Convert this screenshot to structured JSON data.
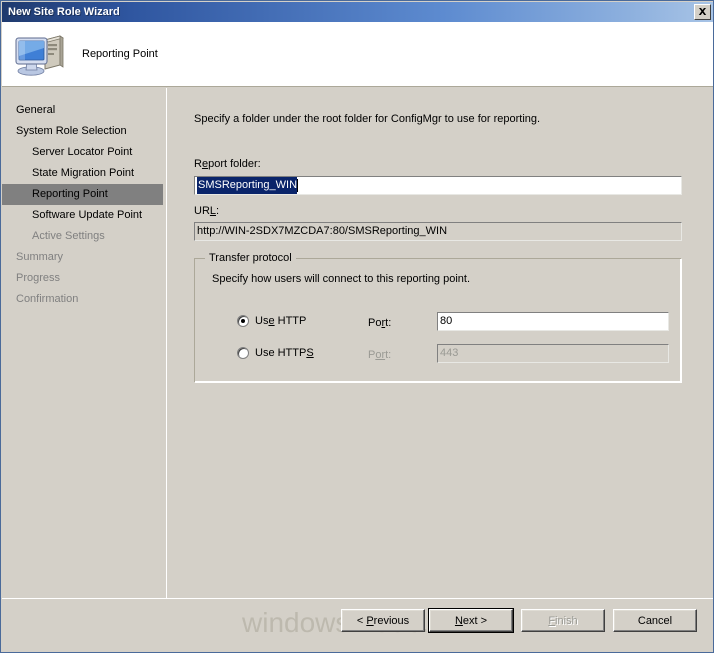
{
  "window": {
    "title": "New Site Role Wizard",
    "close_label": "close-icon"
  },
  "header": {
    "title": "Reporting Point",
    "icon": "computer-icon"
  },
  "sidebar": {
    "items": [
      {
        "label": "General",
        "indent": false,
        "state": "normal"
      },
      {
        "label": "System Role Selection",
        "indent": false,
        "state": "normal"
      },
      {
        "label": "Server Locator Point",
        "indent": true,
        "state": "normal"
      },
      {
        "label": "State Migration Point",
        "indent": true,
        "state": "normal"
      },
      {
        "label": "Reporting Point",
        "indent": true,
        "state": "selected"
      },
      {
        "label": "Software Update Point",
        "indent": true,
        "state": "normal"
      },
      {
        "label": "Active Settings",
        "indent": true,
        "state": "dim"
      },
      {
        "label": "Summary",
        "indent": false,
        "state": "dim"
      },
      {
        "label": "Progress",
        "indent": false,
        "state": "dim"
      },
      {
        "label": "Confirmation",
        "indent": false,
        "state": "dim"
      }
    ]
  },
  "content": {
    "intro": "Specify a folder under the root folder for ConfigMgr to use for reporting.",
    "report_folder": {
      "label_pre": "R",
      "label_acc": "e",
      "label_post": "port folder:",
      "label_full": "Report folder:",
      "value": "SMSReporting_WIN",
      "selected": true
    },
    "url": {
      "label_pre": "UR",
      "label_acc": "L",
      "label_post": ":",
      "label_full": "URL:",
      "value": "http://WIN-2SDX7MZCDA7:80/SMSReporting_WIN",
      "readonly": true
    },
    "transfer_protocol": {
      "legend": "Transfer protocol",
      "description": "Specify how users will connect to this reporting point.",
      "options": [
        {
          "label_pre": "Us",
          "label_acc": "e",
          "label_post": " HTTP",
          "label_full": "Use HTTP",
          "checked": true,
          "port_label_pre": "Po",
          "port_label_acc": "r",
          "port_label_post": "t:",
          "port_label_full": "Port:",
          "port_value": "80",
          "port_enabled": true
        },
        {
          "label_pre": "Use HTTP",
          "label_acc": "S",
          "label_post": "",
          "label_full": "Use HTTPS",
          "checked": false,
          "port_label_pre": "P",
          "port_label_acc": "or",
          "port_label_post": "t:",
          "port_label_full": "Port:",
          "port_value": "443",
          "port_enabled": false
        }
      ]
    }
  },
  "footer": {
    "watermark": "windows-noob.com",
    "buttons": [
      {
        "pre": "< ",
        "acc": "P",
        "post": "revious",
        "full": "< Previous",
        "state": "normal"
      },
      {
        "pre": "",
        "acc": "N",
        "post": "ext >",
        "full": "Next >",
        "state": "default"
      },
      {
        "pre": "",
        "acc": "F",
        "post": "inish",
        "full": "Finish",
        "state": "disabled"
      },
      {
        "pre": "",
        "acc": "",
        "post": "Cancel",
        "full": "Cancel",
        "state": "normal"
      }
    ]
  },
  "colors": {
    "dialog_face": "#d4d0c8",
    "title_start": "#1f3a6e",
    "title_end": "#a8c4e6",
    "selection": "#0a246a",
    "nav_selected": "#808080",
    "disabled_text": "#9a9a94"
  }
}
